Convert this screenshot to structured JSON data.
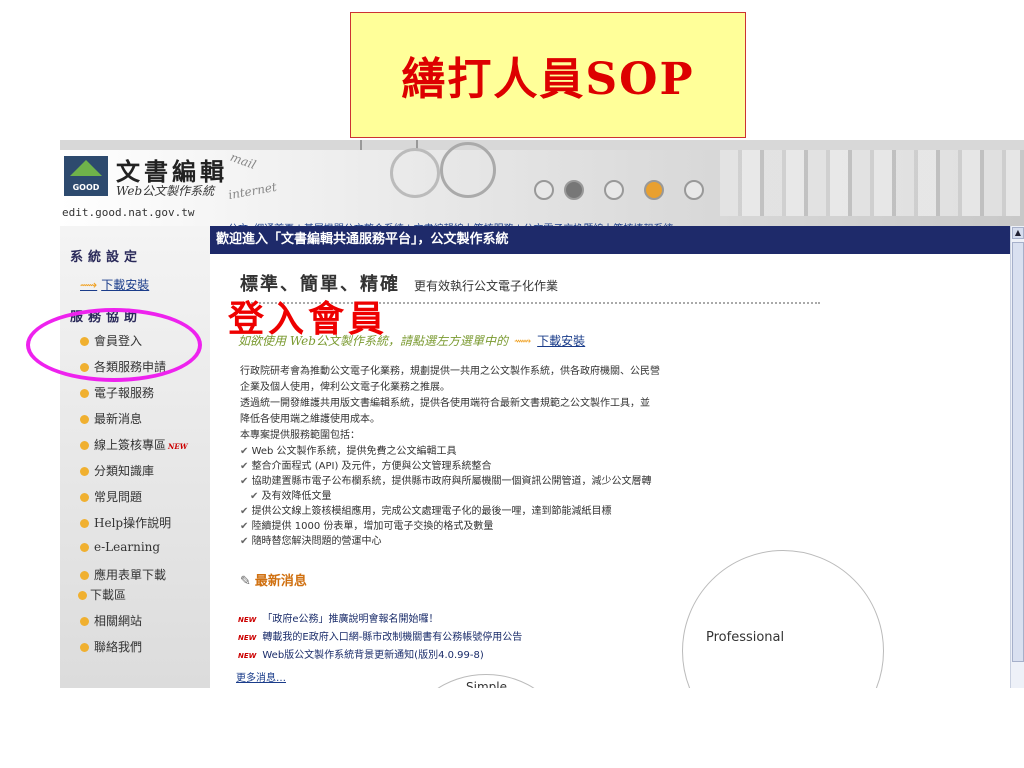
{
  "slide": {
    "title": "繕打人員SOP",
    "overlay_label": "登入會員"
  },
  "banner": {
    "logo_badge": "GOOD",
    "logo_title": "文書編輯",
    "logo_subtitle": "Web公文製作系統",
    "site_url": "edit.good.nat.gov.tw",
    "deco_mail": "mail",
    "deco_internet": "internet",
    "top_links": "公文e網通首頁 | 基層機關公文整合系統 | 文書編輯線上簽核服務 | 公文電子交換暨線上簽核填報系統"
  },
  "sidebar": {
    "section_settings": "系統設定",
    "download_link": "下載安裝",
    "section_services": "服務協助",
    "items": [
      "會員登入",
      "各類服務申請",
      "電子報服務",
      "最新消息",
      "線上簽核專區",
      "分類知識庫",
      "常見問題",
      "Help操作說明",
      "e-Learning",
      "應用表單下載",
      "下載區",
      "相關網站",
      "聯絡我們"
    ],
    "new_badge": "NEW"
  },
  "main": {
    "welcome": "歡迎進入「文書編輯共通服務平台」，公文製作系統",
    "tagline_big": "標準、簡單、精確",
    "tagline_small": "更有效執行公文電子化作業",
    "hint": "如欲使用 Web公文製作系統，請點選左方選單中的",
    "hint_link": "下載安裝",
    "para1_line1": "行政院研考會為推動公文電子化業務，規劃提供一共用之公文製作系統，供各政府機關、公民營",
    "para1_line2": "企業及個人使用，俾利公文電子化業務之推展。",
    "para2_line1": "透過統一開發維護共用版文書編輯系統，提供各使用端符合最新文書規範之公文製作工具，並",
    "para2_line2": "降低各使用端之維護使用成本。",
    "para3": "本專案提供服務範圍包括：",
    "bullets": [
      "Web 公文製作系統，提供免費之公文編輯工具",
      "整合介面程式 (API) 及元件，方便與公文管理系統整合",
      "協助建置縣市電子公布欄系統，提供縣市政府與所屬機關一個資訊公開管道，減少公文層轉",
      "及有效降低文量",
      "提供公文線上簽核模組應用，完成公文處理電子化的最後一哩，達到節能減紙目標",
      "陸續提供 1000 份表單，增加可電子交換的格式及數量",
      "隨時替您解決問題的營運中心"
    ],
    "news_title": "最新消息",
    "news": [
      "「政府e公務」推廣說明會報名開始囉！",
      "轉載我的E政府入口網-縣市改制機關書有公務帳號停用公告",
      "Web版公文製作系統背景更新通知(版別4.0.99-8)"
    ],
    "news_badge": "NEW",
    "more": "更多消息…",
    "professional": "Professional",
    "simple": "Simple"
  }
}
